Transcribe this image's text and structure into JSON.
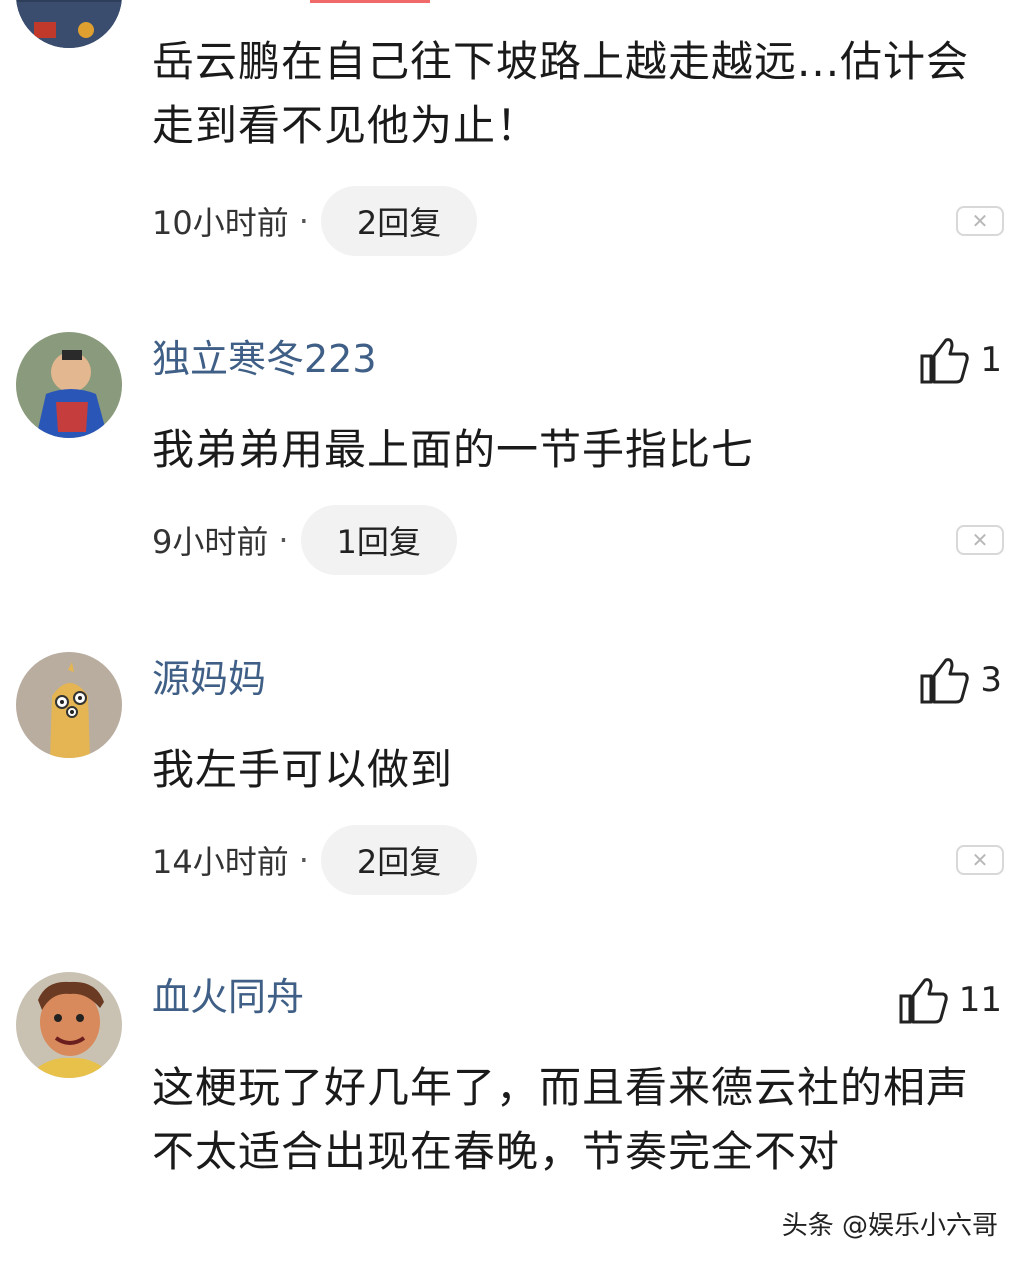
{
  "comments": [
    {
      "username": "",
      "text": "岳云鹏在自己往下坡路上越走越远...估计会走到看不见他为止！",
      "time": "10小时前",
      "separator": "·",
      "replies": "2回复",
      "likes": null,
      "close_icon": "close-icon"
    },
    {
      "username": "独立寒冬223",
      "text": "我弟弟用最上面的一节手指比七",
      "time": "9小时前",
      "separator": "·",
      "replies": "1回复",
      "likes": "1",
      "like_icon": "thumbs-up-icon",
      "close_icon": "close-icon"
    },
    {
      "username": "源妈妈",
      "text": "我左手可以做到",
      "time": "14小时前",
      "separator": "·",
      "replies": "2回复",
      "likes": "3",
      "like_icon": "thumbs-up-icon",
      "close_icon": "close-icon"
    },
    {
      "username": "血火同舟",
      "text": "这梗玩了好几年了，而且看来德云社的相声不太适合出现在春晚，节奏完全不对",
      "time": "",
      "separator": "",
      "replies": "",
      "likes": "11",
      "like_icon": "thumbs-up-icon"
    }
  ],
  "watermark": "头条 @娱乐小六哥",
  "colors": {
    "username": "#3f5f86",
    "reply_pill_bg": "#f2f2f2",
    "accent": "#f06a6a"
  }
}
